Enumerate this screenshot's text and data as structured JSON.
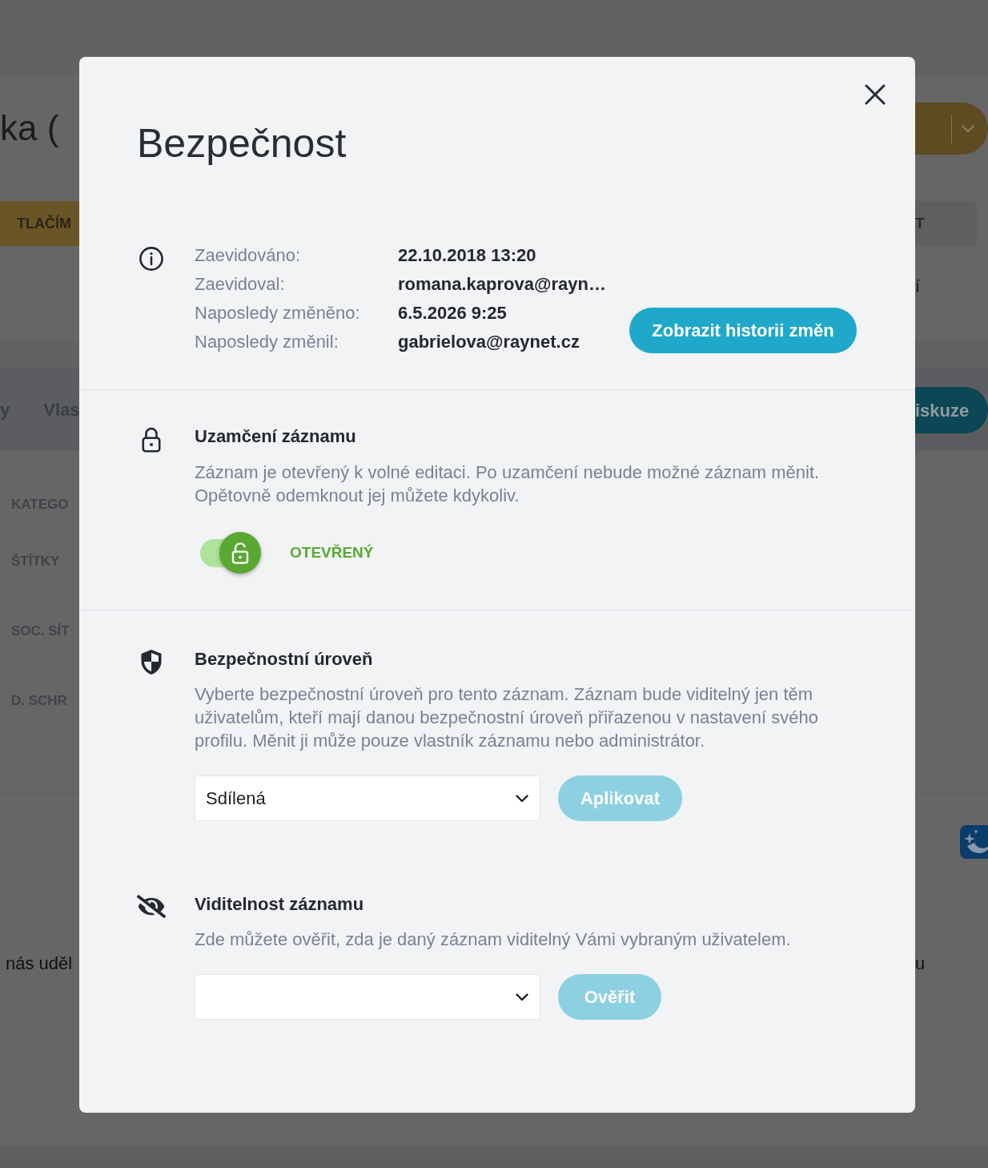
{
  "background": {
    "title": "ka (",
    "action_button": "TLAČÍM",
    "side_button": "T",
    "side_text": "í",
    "tabs": [
      "y",
      "Vlas"
    ],
    "tab_button": "iskuze",
    "field_labels": [
      "KATEGO",
      "ŠTÍTKY",
      "SOC. SÍT",
      "D. SCHR"
    ],
    "footer_text_left": "nás uděl",
    "footer_text_right": "u"
  },
  "dialog": {
    "title": "Bezpečnost",
    "sections": [
      {
        "kind": "info",
        "rows": [
          {
            "label": "Zaevidováno:",
            "value": "22.10.2018 13:20"
          },
          {
            "label": "Zaevidoval:",
            "value": "romana.kaprova@rayn…"
          },
          {
            "label": "Naposledy změněno:",
            "value": "6.5.2026 9:25"
          },
          {
            "label": "Naposledy změnil:",
            "value": "gabrielova@raynet.cz"
          }
        ],
        "button": {
          "label": "Zobrazit historii změn",
          "disabled": false
        }
      },
      {
        "kind": "lock",
        "heading": "Uzamčení záznamu",
        "description": "Záznam je otevřený k volné editaci. Po uzamčení nebude možné záznam měnit. Opětovně odemknout jej můžete kdykoliv.",
        "locked": false,
        "status": "OTEVŘENÝ"
      },
      {
        "kind": "level",
        "heading": "Bezpečnostní úroveň",
        "description": "Vyberte bezpečnostní úroveň pro tento záznam. Záznam bude viditelný jen těm uživatelům, kteří mají danou bezpečnostní úroveň přiřazenou v nastavení svého profilu. Měnit ji může pouze vlastník záznamu nebo administrátor.",
        "select": {
          "value": "Sdílená"
        },
        "button": {
          "label": "Aplikovat",
          "disabled": true
        }
      },
      {
        "kind": "visibility",
        "heading": "Viditelnost záznamu",
        "description": "Zde můžete ověřit, zda je daný záznam viditelný Vámi vybraným uživatelem.",
        "button": {
          "label": "Ověřit",
          "disabled": true
        }
      }
    ]
  }
}
